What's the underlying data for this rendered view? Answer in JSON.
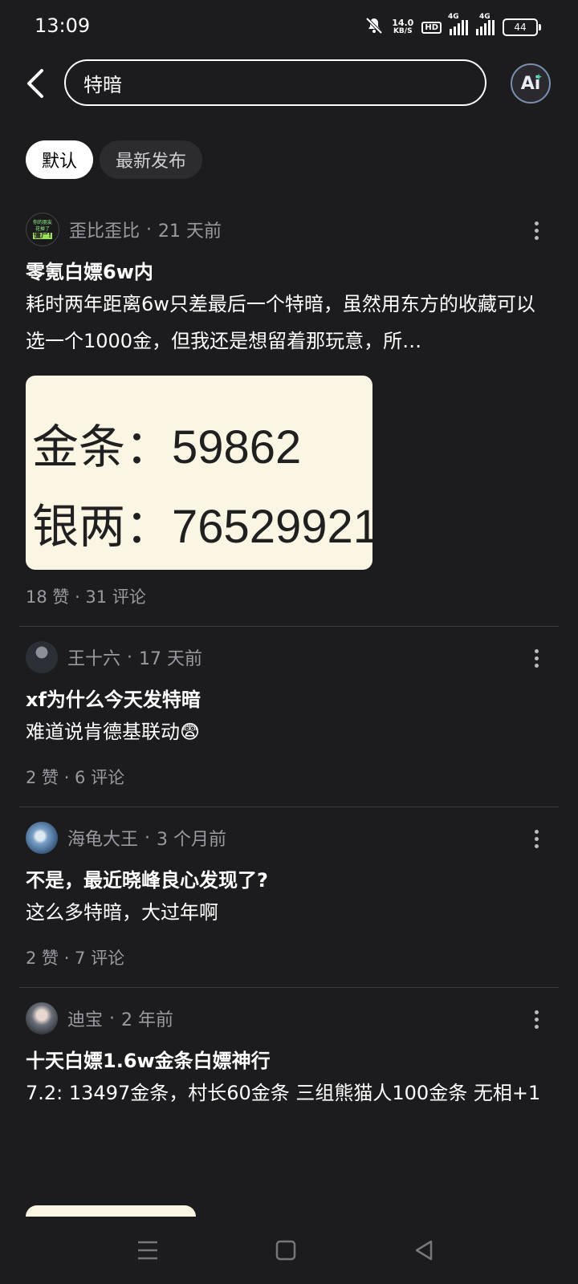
{
  "status": {
    "time": "13:09",
    "net_speed_value": "14.0",
    "net_speed_unit": "KB/S",
    "hd_label": "HD",
    "sim1_label": "4G",
    "sim2_label": "4G",
    "battery": "44",
    "icons": [
      "mute-icon",
      "hd-icon",
      "signal-icon",
      "signal-icon",
      "battery-icon"
    ]
  },
  "header": {
    "back_icon": "chevron-left-icon",
    "search_value": "特暗",
    "ai_label": "Ai"
  },
  "tabs": [
    {
      "label": "默认",
      "active": true
    },
    {
      "label": "最新发布",
      "active": false
    }
  ],
  "posts": [
    {
      "author": "歪比歪比",
      "time": "21 天前",
      "title": "零氪白嫖6w内",
      "body": "耗时两年距离6w只差最后一个特暗，虽然用东方的收藏可以选一个1000金，但我还是想留着那玩意，所…",
      "image_lines": [
        "金条：59862",
        "银两：76529921"
      ],
      "stats": "18 赞 · 31 评论"
    },
    {
      "author": "王十六",
      "time": "17 天前",
      "title": "xf为什么今天发特暗",
      "body": "难道说肯德基联动",
      "emoji": "😨",
      "stats": "2 赞 · 6 评论"
    },
    {
      "author": "海龟大王",
      "time": "3 个月前",
      "title": "不是，最近晓峰良心发现了?",
      "body": "这么多特暗，大过年啊",
      "stats": "2 赞 · 7 评论"
    },
    {
      "author": "迪宝",
      "time": "2 年前",
      "title": "十天白嫖1.6w金条白嫖神行",
      "body": "7.2: 13497金条，村长60金条 三组熊猫人100金条 无相+1"
    }
  ],
  "avatar1_text": [
    "你的朋友",
    "花掉了",
    "僵尸!"
  ],
  "nav": [
    "menu-icon",
    "home-icon",
    "back-icon"
  ],
  "colors": {
    "background": "#1c1c1e",
    "tab_active_bg": "#ffffff",
    "tab_inactive_bg": "#2c2c2e",
    "meta_text": "#9a9aa0",
    "image_bg": "#fbf5e4"
  }
}
